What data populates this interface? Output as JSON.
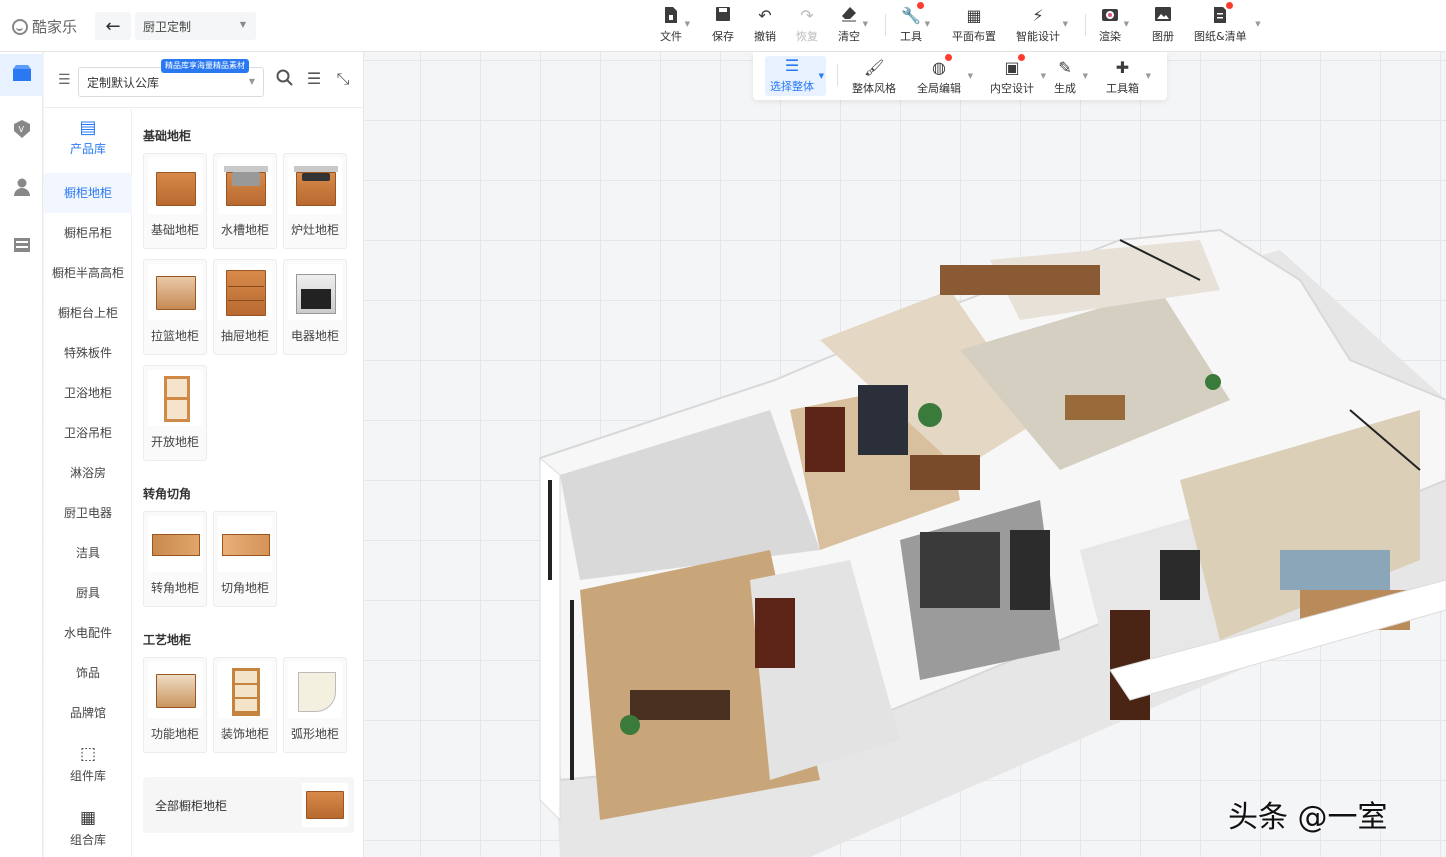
{
  "app": {
    "name": "酷家乐",
    "mode": "厨卫定制"
  },
  "toolbar": [
    {
      "id": "file",
      "label": "文件",
      "icon": "file-icon",
      "dropdown": true
    },
    {
      "id": "save",
      "label": "保存",
      "icon": "save-icon",
      "dropdown": false
    },
    {
      "id": "undo",
      "label": "撤销",
      "icon": "undo-icon",
      "dropdown": false
    },
    {
      "id": "redo",
      "label": "恢复",
      "icon": "redo-icon",
      "dropdown": false,
      "disabled": true
    },
    {
      "id": "clear",
      "label": "清空",
      "icon": "eraser-icon",
      "dropdown": true
    },
    {
      "id": "tools",
      "label": "工具",
      "icon": "wrench-icon",
      "dropdown": true,
      "notify": true
    },
    {
      "id": "layout",
      "label": "平面布置",
      "icon": "floorplan-icon",
      "dropdown": false
    },
    {
      "id": "smart",
      "label": "智能设计",
      "icon": "lightning-icon",
      "dropdown": true
    },
    {
      "id": "render",
      "label": "渲染",
      "icon": "camera-icon",
      "dropdown": true
    },
    {
      "id": "album",
      "label": "图册",
      "icon": "image-icon",
      "dropdown": false
    },
    {
      "id": "drawings",
      "label": "图纸&清单",
      "icon": "document-icon",
      "dropdown": true,
      "notify": true
    }
  ],
  "subtoolbar": [
    {
      "id": "select-all",
      "label": "选择整体",
      "icon": "select-icon",
      "active": true,
      "dropdown": true
    },
    {
      "id": "style",
      "label": "整体风格",
      "icon": "paint-roller-icon"
    },
    {
      "id": "global-edit",
      "label": "全局编辑",
      "icon": "globe-edit-icon",
      "dropdown": true,
      "notify": true
    },
    {
      "id": "interior",
      "label": "内空设计",
      "icon": "frame-icon",
      "dropdown": true,
      "notify": true
    },
    {
      "id": "generate",
      "label": "生成",
      "icon": "generate-icon",
      "dropdown": true
    },
    {
      "id": "toolbox",
      "label": "工具箱",
      "icon": "puzzle-icon",
      "dropdown": true
    }
  ],
  "rail": [
    {
      "icon": "library-icon",
      "active": true
    },
    {
      "icon": "vip-icon"
    },
    {
      "icon": "user-icon"
    },
    {
      "icon": "cabinet-icon"
    }
  ],
  "panel": {
    "library": "定制默认公库",
    "promo": "精品库享海量精品素材",
    "product_lib": "产品库",
    "categories": [
      "橱柜地柜",
      "橱柜吊柜",
      "橱柜半高高柜",
      "橱柜台上柜",
      "特殊板件",
      "卫浴地柜",
      "卫浴吊柜",
      "淋浴房",
      "厨卫电器",
      "洁具",
      "厨具",
      "水电配件",
      "饰品",
      "品牌馆"
    ],
    "bottom_tools": [
      {
        "label": "组件库",
        "icon": "component-icon"
      },
      {
        "label": "组合库",
        "icon": "combo-icon"
      }
    ],
    "sections": [
      {
        "title": "基础地柜",
        "items": [
          "基础地柜",
          "水槽地柜",
          "炉灶地柜",
          "拉篮地柜",
          "抽屉地柜",
          "电器地柜",
          "开放地柜"
        ]
      },
      {
        "title": "转角切角",
        "items": [
          "转角地柜",
          "切角地柜"
        ]
      },
      {
        "title": "工艺地柜",
        "items": [
          "功能地柜",
          "装饰地柜",
          "弧形地柜"
        ]
      }
    ],
    "all_label": "全部橱柜地柜"
  },
  "watermark": "头条 @一室"
}
